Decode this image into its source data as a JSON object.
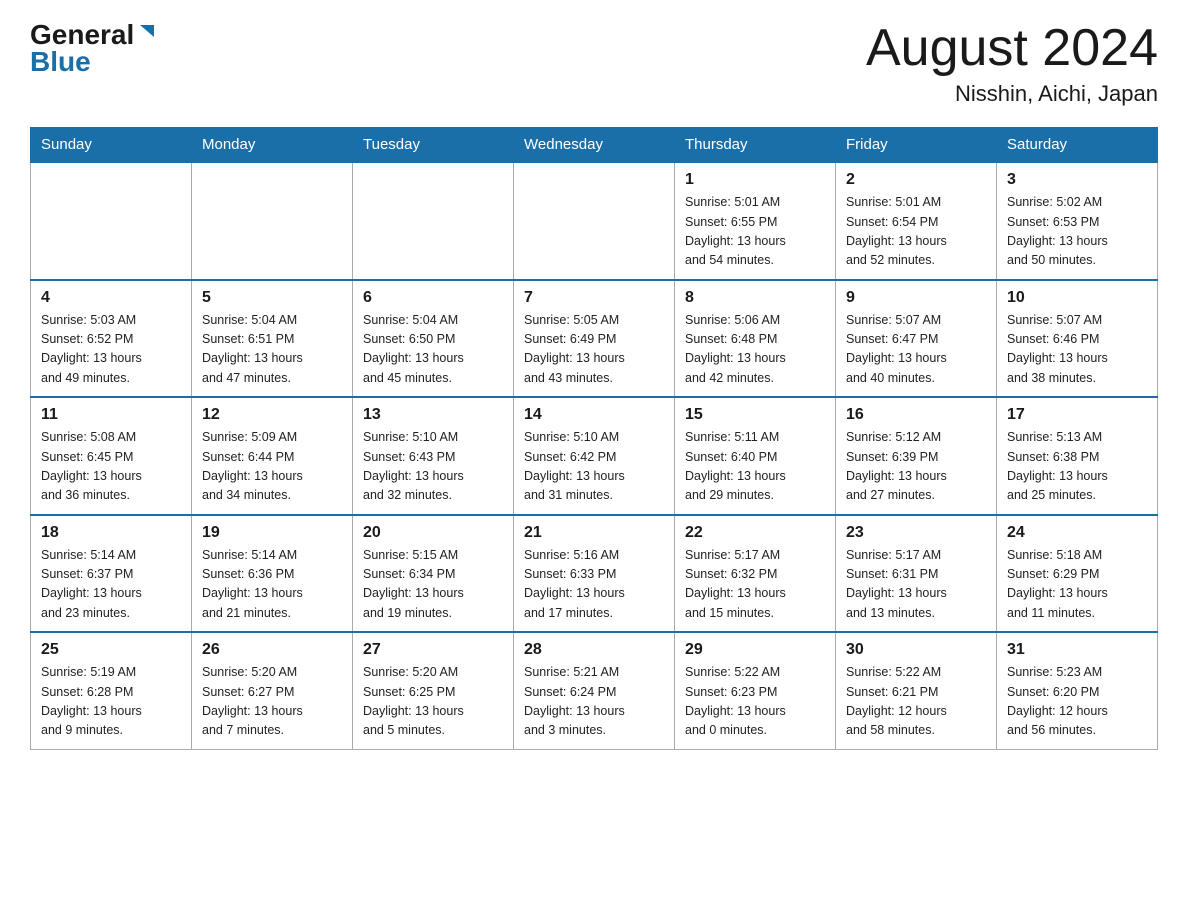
{
  "header": {
    "logo_general": "General",
    "logo_blue": "Blue",
    "month_year": "August 2024",
    "location": "Nisshin, Aichi, Japan"
  },
  "weekdays": [
    "Sunday",
    "Monday",
    "Tuesday",
    "Wednesday",
    "Thursday",
    "Friday",
    "Saturday"
  ],
  "weeks": [
    [
      {
        "day": "",
        "info": ""
      },
      {
        "day": "",
        "info": ""
      },
      {
        "day": "",
        "info": ""
      },
      {
        "day": "",
        "info": ""
      },
      {
        "day": "1",
        "info": "Sunrise: 5:01 AM\nSunset: 6:55 PM\nDaylight: 13 hours\nand 54 minutes."
      },
      {
        "day": "2",
        "info": "Sunrise: 5:01 AM\nSunset: 6:54 PM\nDaylight: 13 hours\nand 52 minutes."
      },
      {
        "day": "3",
        "info": "Sunrise: 5:02 AM\nSunset: 6:53 PM\nDaylight: 13 hours\nand 50 minutes."
      }
    ],
    [
      {
        "day": "4",
        "info": "Sunrise: 5:03 AM\nSunset: 6:52 PM\nDaylight: 13 hours\nand 49 minutes."
      },
      {
        "day": "5",
        "info": "Sunrise: 5:04 AM\nSunset: 6:51 PM\nDaylight: 13 hours\nand 47 minutes."
      },
      {
        "day": "6",
        "info": "Sunrise: 5:04 AM\nSunset: 6:50 PM\nDaylight: 13 hours\nand 45 minutes."
      },
      {
        "day": "7",
        "info": "Sunrise: 5:05 AM\nSunset: 6:49 PM\nDaylight: 13 hours\nand 43 minutes."
      },
      {
        "day": "8",
        "info": "Sunrise: 5:06 AM\nSunset: 6:48 PM\nDaylight: 13 hours\nand 42 minutes."
      },
      {
        "day": "9",
        "info": "Sunrise: 5:07 AM\nSunset: 6:47 PM\nDaylight: 13 hours\nand 40 minutes."
      },
      {
        "day": "10",
        "info": "Sunrise: 5:07 AM\nSunset: 6:46 PM\nDaylight: 13 hours\nand 38 minutes."
      }
    ],
    [
      {
        "day": "11",
        "info": "Sunrise: 5:08 AM\nSunset: 6:45 PM\nDaylight: 13 hours\nand 36 minutes."
      },
      {
        "day": "12",
        "info": "Sunrise: 5:09 AM\nSunset: 6:44 PM\nDaylight: 13 hours\nand 34 minutes."
      },
      {
        "day": "13",
        "info": "Sunrise: 5:10 AM\nSunset: 6:43 PM\nDaylight: 13 hours\nand 32 minutes."
      },
      {
        "day": "14",
        "info": "Sunrise: 5:10 AM\nSunset: 6:42 PM\nDaylight: 13 hours\nand 31 minutes."
      },
      {
        "day": "15",
        "info": "Sunrise: 5:11 AM\nSunset: 6:40 PM\nDaylight: 13 hours\nand 29 minutes."
      },
      {
        "day": "16",
        "info": "Sunrise: 5:12 AM\nSunset: 6:39 PM\nDaylight: 13 hours\nand 27 minutes."
      },
      {
        "day": "17",
        "info": "Sunrise: 5:13 AM\nSunset: 6:38 PM\nDaylight: 13 hours\nand 25 minutes."
      }
    ],
    [
      {
        "day": "18",
        "info": "Sunrise: 5:14 AM\nSunset: 6:37 PM\nDaylight: 13 hours\nand 23 minutes."
      },
      {
        "day": "19",
        "info": "Sunrise: 5:14 AM\nSunset: 6:36 PM\nDaylight: 13 hours\nand 21 minutes."
      },
      {
        "day": "20",
        "info": "Sunrise: 5:15 AM\nSunset: 6:34 PM\nDaylight: 13 hours\nand 19 minutes."
      },
      {
        "day": "21",
        "info": "Sunrise: 5:16 AM\nSunset: 6:33 PM\nDaylight: 13 hours\nand 17 minutes."
      },
      {
        "day": "22",
        "info": "Sunrise: 5:17 AM\nSunset: 6:32 PM\nDaylight: 13 hours\nand 15 minutes."
      },
      {
        "day": "23",
        "info": "Sunrise: 5:17 AM\nSunset: 6:31 PM\nDaylight: 13 hours\nand 13 minutes."
      },
      {
        "day": "24",
        "info": "Sunrise: 5:18 AM\nSunset: 6:29 PM\nDaylight: 13 hours\nand 11 minutes."
      }
    ],
    [
      {
        "day": "25",
        "info": "Sunrise: 5:19 AM\nSunset: 6:28 PM\nDaylight: 13 hours\nand 9 minutes."
      },
      {
        "day": "26",
        "info": "Sunrise: 5:20 AM\nSunset: 6:27 PM\nDaylight: 13 hours\nand 7 minutes."
      },
      {
        "day": "27",
        "info": "Sunrise: 5:20 AM\nSunset: 6:25 PM\nDaylight: 13 hours\nand 5 minutes."
      },
      {
        "day": "28",
        "info": "Sunrise: 5:21 AM\nSunset: 6:24 PM\nDaylight: 13 hours\nand 3 minutes."
      },
      {
        "day": "29",
        "info": "Sunrise: 5:22 AM\nSunset: 6:23 PM\nDaylight: 13 hours\nand 0 minutes."
      },
      {
        "day": "30",
        "info": "Sunrise: 5:22 AM\nSunset: 6:21 PM\nDaylight: 12 hours\nand 58 minutes."
      },
      {
        "day": "31",
        "info": "Sunrise: 5:23 AM\nSunset: 6:20 PM\nDaylight: 12 hours\nand 56 minutes."
      }
    ]
  ]
}
